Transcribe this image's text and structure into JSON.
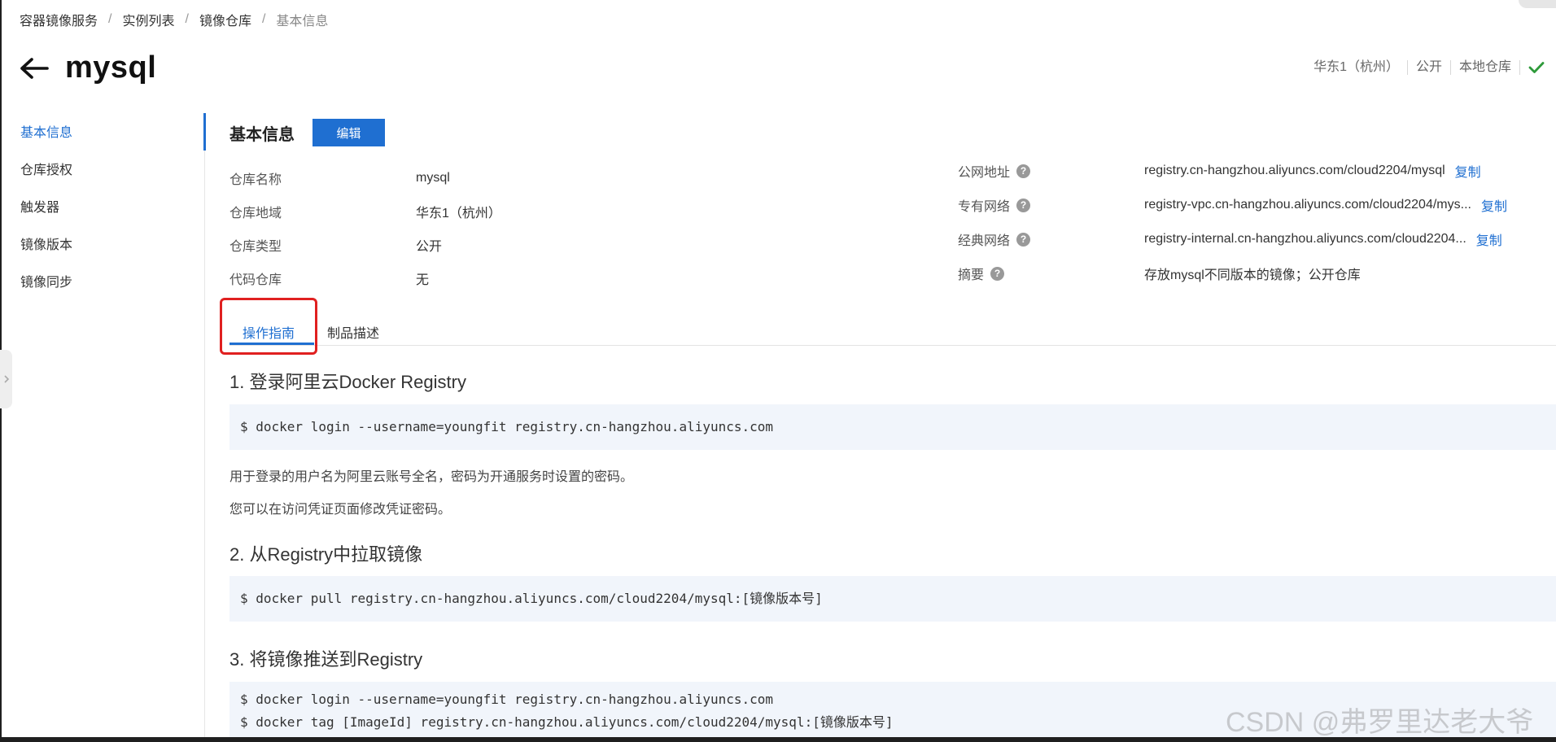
{
  "breadcrumb": [
    "容器镜像服务",
    "实例列表",
    "镜像仓库",
    "基本信息"
  ],
  "header": {
    "title": "mysql",
    "meta": [
      "华东1（杭州）",
      "公开",
      "本地仓库"
    ]
  },
  "sidebar": {
    "items": [
      {
        "label": "基本信息"
      },
      {
        "label": "仓库授权"
      },
      {
        "label": "触发器"
      },
      {
        "label": "镜像版本"
      },
      {
        "label": "镜像同步"
      }
    ]
  },
  "info": {
    "title": "基本信息",
    "edit_label": "编辑",
    "left": [
      {
        "label": "仓库名称",
        "value": "mysql"
      },
      {
        "label": "仓库地域",
        "value": "华东1（杭州）"
      },
      {
        "label": "仓库类型",
        "value": "公开"
      },
      {
        "label": "代码仓库",
        "value": "无"
      }
    ],
    "right": [
      {
        "label": "公网地址",
        "value": "registry.cn-hangzhou.aliyuncs.com/cloud2204/mysql",
        "copy": "复制"
      },
      {
        "label": "专有网络",
        "value": "registry-vpc.cn-hangzhou.aliyuncs.com/cloud2204/mys...",
        "copy": "复制"
      },
      {
        "label": "经典网络",
        "value": "registry-internal.cn-hangzhou.aliyuncs.com/cloud2204...",
        "copy": "复制"
      },
      {
        "label": "摘要",
        "value": "存放mysql不同版本的镜像；公开仓库"
      }
    ]
  },
  "tabs": [
    {
      "label": "操作指南"
    },
    {
      "label": "制品描述"
    }
  ],
  "guide": {
    "sections": [
      {
        "title": "1. 登录阿里云Docker Registry",
        "code": [
          "$ docker login --username=youngfit registry.cn-hangzhou.aliyuncs.com"
        ]
      },
      {
        "title": "2. 从Registry中拉取镜像",
        "code": [
          "$ docker pull registry.cn-hangzhou.aliyuncs.com/cloud2204/mysql:[镜像版本号]"
        ]
      },
      {
        "title": "3. 将镜像推送到Registry",
        "code": [
          "$ docker login --username=youngfit registry.cn-hangzhou.aliyuncs.com",
          "$ docker tag [ImageId] registry.cn-hangzhou.aliyuncs.com/cloud2204/mysql:[镜像版本号]"
        ]
      }
    ],
    "notes": [
      "用于登录的用户名为阿里云账号全名，密码为开通服务时设置的密码。",
      "您可以在访问凭证页面修改凭证密码。"
    ]
  },
  "watermark": "CSDN @弗罗里达老大爷",
  "colors": {
    "accent": "#1f6fd1",
    "highlight": "#e02020",
    "success": "#2e9a3a"
  }
}
